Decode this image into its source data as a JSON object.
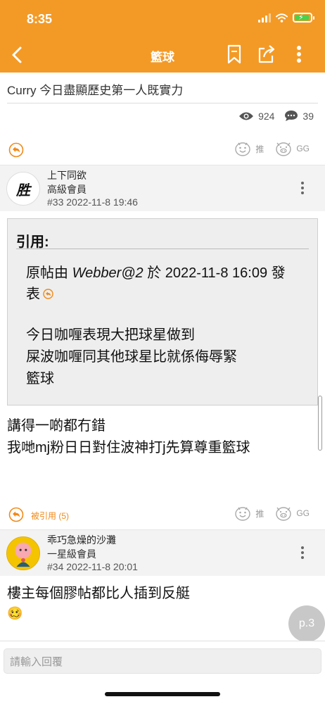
{
  "status_bar": {
    "time": "8:35"
  },
  "nav": {
    "title": "籃球",
    "back_icon": "chevron-left-icon",
    "actions": [
      "bookmark-icon",
      "share-icon",
      "more-vertical-icon"
    ]
  },
  "thread": {
    "title": "Curry 今日盡顯歷史第一人既實力",
    "views": "924",
    "replies": "39"
  },
  "vote_labels": {
    "up": "推",
    "down": "GG"
  },
  "posts": [
    {
      "avatar_text": "胜",
      "username": "上下同欲",
      "rank": "高級會員",
      "meta": "#33 2022-11-8 19:46",
      "quote": {
        "label": "引用:",
        "source_prefix": "原帖由 ",
        "source_author": "Webber@2",
        "source_suffix": " 於 2022-11-8 16:09 發表",
        "lines": [
          "今日咖喱表現大把球星做到",
          "屎波咖喱同其他球星比就係侮辱緊",
          "籃球"
        ]
      },
      "body_lines": [
        "講得一啲都冇錯",
        "我哋mj粉日日對住波神打j先算尊重籃球"
      ],
      "quoted_by": "被引用 (5)"
    },
    {
      "username": "乖巧急燥的沙灘",
      "rank": "一星級會員",
      "meta": "#34 2022-11-8 20:01",
      "body_lines": [
        "樓主每個膠帖都比人插到反艇",
        "🥴"
      ]
    }
  ],
  "page_indicator": "p.3",
  "reply": {
    "placeholder": "請輸入回覆"
  },
  "colors": {
    "accent": "#f39a26",
    "link": "#f08a19"
  }
}
